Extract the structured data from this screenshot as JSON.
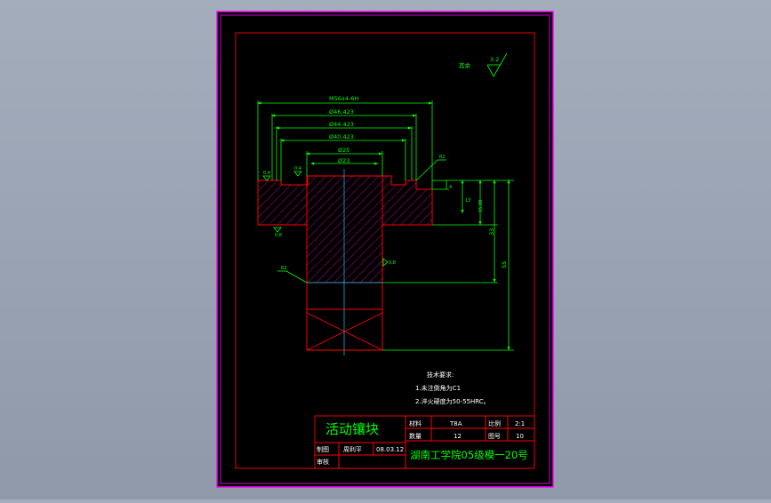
{
  "drawing": {
    "part_name": "活动镶块",
    "surface_rest_label": "其余",
    "surface_rest_value": "3.2",
    "dimensions": {
      "thread": "M56x4-6H",
      "d1": "Ø46.423",
      "d2": "Ø44.423",
      "d3": "Ø40.423",
      "d4": "Ø25",
      "d5": "Ø23",
      "h4": "4",
      "h13": "13",
      "h15": "15.88",
      "h33": "33",
      "h55": "55",
      "r_top": "R2",
      "r_left": "R2",
      "rough_a": "0.4",
      "rough_b": "0.4",
      "rough_c": "0.8",
      "rough_d": "0.8"
    },
    "tech_req": {
      "title": "技术要求:",
      "item1": "1.未注倒角为C1",
      "item2": "2.淬火硬度为50-55HRC。"
    },
    "title_block": {
      "material_label": "材料",
      "material_value": "T8A",
      "scale_label": "比例",
      "scale_value": "2:1",
      "qty_label": "数量",
      "qty_value": "12",
      "drawing_no_label": "图号",
      "drawing_no_value": "10",
      "drawn_label": "制图",
      "drawn_name": "周利平",
      "drawn_date": "08.03.12",
      "check_label": "审核",
      "school": "湖南工学院05级模一20号"
    }
  },
  "colors": {
    "outline": "#ff0000",
    "dimension": "#00ff00",
    "centerline": "#00c8ff",
    "border": "#ff00ff",
    "hatch": "#a0007a",
    "paper": "#000000"
  }
}
